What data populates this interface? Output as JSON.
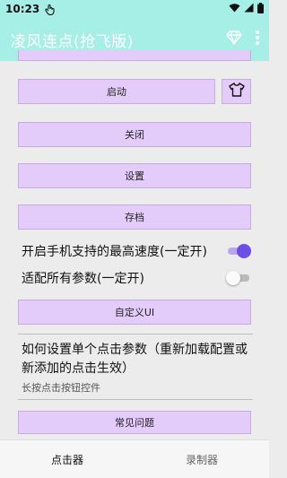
{
  "status_bar": {
    "time": "10:23"
  },
  "app_bar": {
    "title": "凌风连点(抢飞版)"
  },
  "buttons": {
    "start": "启动",
    "close": "关闭",
    "settings": "设置",
    "save": "存档",
    "customize": "自定义UI",
    "faq": "常见问题"
  },
  "toggles": [
    {
      "label": "开启手机支持的最高速度(一定开)",
      "on": true
    },
    {
      "label": "适配所有参数(一定开)",
      "on": false
    }
  ],
  "info": {
    "title": "如何设置单个点击参数（重新加载配置或新添加的点击生效）",
    "subtitle": "长按点击按钮控件"
  },
  "bottom_nav": {
    "tab_clicker": "点击器",
    "tab_recorder": "录制器"
  },
  "colors": {
    "header": "#a6efe6",
    "button": "#e3ccfa",
    "switch_on": "#6c4de6"
  }
}
